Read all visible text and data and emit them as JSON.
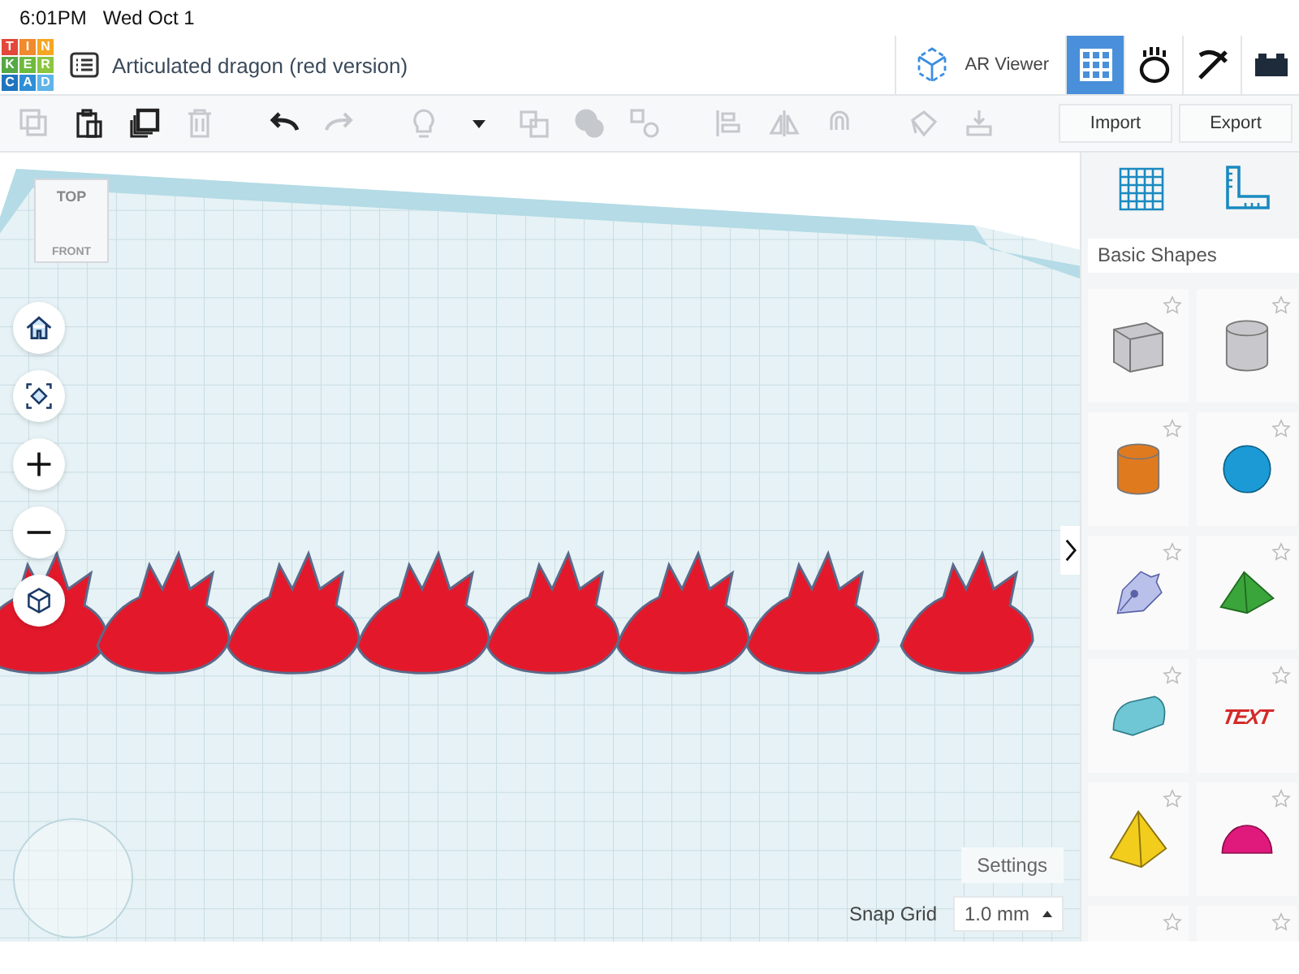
{
  "status_bar": {
    "time": "6:01PM",
    "date": "Wed Oct 1"
  },
  "header": {
    "logo": [
      {
        "letter": "T",
        "color": "#e4473b"
      },
      {
        "letter": "I",
        "color": "#f08a2c"
      },
      {
        "letter": "N",
        "color": "#f5a623"
      },
      {
        "letter": "K",
        "color": "#56a845"
      },
      {
        "letter": "E",
        "color": "#6dbb3e"
      },
      {
        "letter": "R",
        "color": "#8cc63f"
      },
      {
        "letter": "C",
        "color": "#1f74bf"
      },
      {
        "letter": "A",
        "color": "#2f8fd6"
      },
      {
        "letter": "D",
        "color": "#5fb4e8"
      }
    ],
    "title": "Articulated dragon (red version)",
    "ar_viewer": "AR Viewer",
    "views": [
      {
        "kind": "grid",
        "selected": true
      },
      {
        "kind": "blocks",
        "selected": false
      },
      {
        "kind": "pickaxe",
        "selected": false
      },
      {
        "kind": "brick",
        "selected": false
      }
    ]
  },
  "toolbar": {
    "tools": [
      {
        "kind": "copy",
        "disabled": true
      },
      {
        "kind": "paste",
        "disabled": false
      },
      {
        "kind": "duplicate",
        "disabled": false
      },
      {
        "kind": "delete",
        "disabled": true
      },
      {
        "kind": "undo",
        "disabled": false
      },
      {
        "kind": "redo",
        "disabled": true
      },
      {
        "kind": "light",
        "disabled": true
      },
      {
        "kind": "caret",
        "disabled": false
      },
      {
        "kind": "group",
        "disabled": true
      },
      {
        "kind": "union",
        "disabled": true
      },
      {
        "kind": "ungroup",
        "disabled": true
      },
      {
        "kind": "align",
        "disabled": true
      },
      {
        "kind": "mirror",
        "disabled": true
      },
      {
        "kind": "magnet",
        "disabled": true
      },
      {
        "kind": "workplane",
        "disabled": true
      },
      {
        "kind": "drop",
        "disabled": true
      }
    ],
    "import": "Import",
    "export": "Export"
  },
  "viewcube": {
    "top": "TOP",
    "front": "FRONT"
  },
  "settings": "Settings",
  "snap_grid": {
    "label": "Snap Grid",
    "value": "1.0 mm"
  },
  "panel": {
    "category": "Basic Shapes",
    "shapes": [
      {
        "kind": "box",
        "color": "#c8c8cc"
      },
      {
        "kind": "cylinder",
        "color": "#c8c8cc"
      },
      {
        "kind": "cylinder",
        "color": "#e07a1f"
      },
      {
        "kind": "sphere",
        "color": "#1b9ad6"
      },
      {
        "kind": "scribble",
        "color": "#b9c0ea"
      },
      {
        "kind": "roof",
        "color": "#3aa53a"
      },
      {
        "kind": "round-roof",
        "color": "#6fc6d4"
      },
      {
        "kind": "text",
        "color": "#d42a2a",
        "text": "TEXT"
      },
      {
        "kind": "pyramid",
        "color": "#f2cd1c"
      },
      {
        "kind": "half-sphere",
        "color": "#e0197d"
      },
      {
        "kind": "partial"
      },
      {
        "kind": "partial"
      }
    ]
  }
}
